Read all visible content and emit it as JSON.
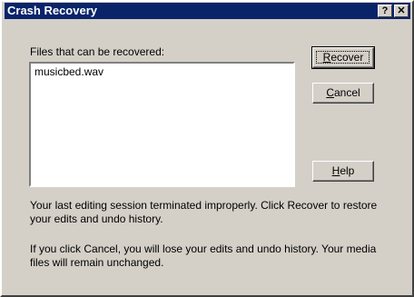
{
  "window": {
    "title": "Crash Recovery",
    "help_button": "?",
    "close_button": "✕"
  },
  "files_label": "Files that can be recovered:",
  "files": [
    "musicbed.wav"
  ],
  "buttons": {
    "recover": {
      "accel": "R",
      "rest": "ecover"
    },
    "cancel": {
      "accel": "C",
      "rest": "ancel"
    },
    "help": {
      "accel": "H",
      "rest": "elp"
    }
  },
  "messages": {
    "session": "Your last editing session terminated improperly. Click Recover to restore your edits and undo history.",
    "cancel_warning": "If you click Cancel, you will lose your edits and undo history. Your media files will remain unchanged."
  },
  "colors": {
    "titlebar": "#0a246a",
    "face": "#d4d0c8"
  }
}
